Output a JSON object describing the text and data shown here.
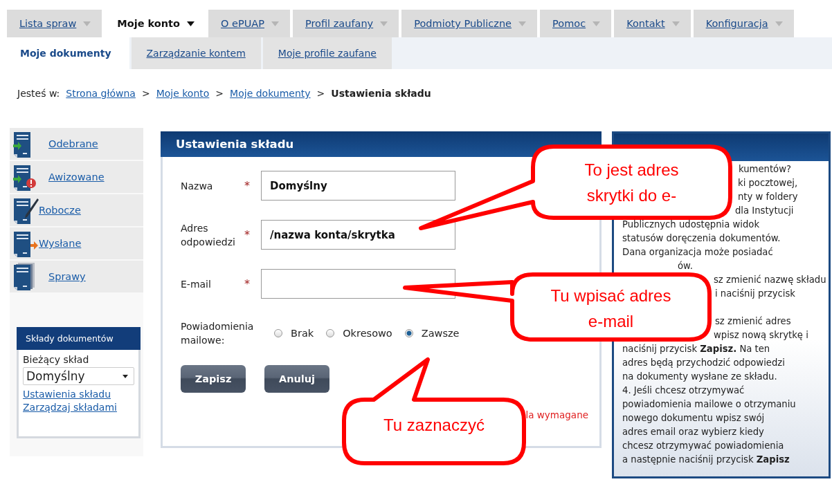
{
  "top_tabs": [
    {
      "label": "Lista spraw",
      "selected": false
    },
    {
      "label": "Moje konto",
      "selected": true
    },
    {
      "label": "O ePUAP",
      "selected": false
    },
    {
      "label": "Profil zaufany",
      "selected": false
    },
    {
      "label": "Podmioty Publiczne",
      "selected": false
    },
    {
      "label": "Pomoc",
      "selected": false
    },
    {
      "label": "Kontakt",
      "selected": false
    },
    {
      "label": "Konfiguracja",
      "selected": false
    }
  ],
  "sub_tabs": [
    {
      "label": "Moje dokumenty",
      "selected": true
    },
    {
      "label": "Zarządzanie kontem",
      "selected": false
    },
    {
      "label": "Moje profile zaufane",
      "selected": false
    }
  ],
  "breadcrumb": [
    {
      "text": "Jesteś w:",
      "kind": "prefix"
    },
    {
      "text": "Strona główna",
      "kind": "link"
    },
    {
      "text": ">",
      "kind": "separator"
    },
    {
      "text": "Moje konto",
      "kind": "link"
    },
    {
      "text": ">",
      "kind": "separator"
    },
    {
      "text": "Moje dokumenty",
      "kind": "link"
    },
    {
      "text": ">",
      "kind": "separator"
    },
    {
      "text": "Ustawienia składu",
      "kind": "current"
    }
  ],
  "sidebar": {
    "items": [
      {
        "label": "Odebrane",
        "kind": "received"
      },
      {
        "label": "Awizowane",
        "kind": "notice"
      },
      {
        "label": "Robocze",
        "kind": "draft"
      },
      {
        "label": "Wysłane",
        "kind": "sent"
      },
      {
        "label": "Sprawy",
        "kind": "cases"
      }
    ]
  },
  "store_box": {
    "title": "Składy dokumentów",
    "current_label": "Bieżący skład",
    "select_value": "Domyślny",
    "links": [
      "Ustawienia składu",
      "Zarządzaj składami"
    ]
  },
  "form": {
    "title": "Ustawienia składu",
    "fields": [
      {
        "label": "Nazwa",
        "required_mark": "*",
        "value": "Domyślny"
      },
      {
        "label": "Adres odpowiedzi",
        "required_mark": "*",
        "value": "/nazwa konta/skrytka"
      },
      {
        "label": "E-mail",
        "required_mark": "*"
      }
    ],
    "notifications": {
      "label": "Powiadomienia mailowe:",
      "options": [
        {
          "label": "Brak",
          "selected": false
        },
        {
          "label": "Okresowo",
          "selected": false
        },
        {
          "label": "Zawsze",
          "selected": true
        }
      ]
    },
    "buttons": [
      "Zapisz",
      "Anuluj"
    ],
    "required_note": "la wymagane"
  },
  "help_panel": {
    "lines_top": [
      "kumentów?",
      "ki pocztowej,",
      "nty w foldery",
      "dla Instytucji",
      "Publicznych udostępnia widok",
      "statusów doręczenia dokumentów.",
      "Dana organizacja może posiadać",
      "ów.",
      "sz zmienić nazwę składu",
      "i naciśnij przycisk"
    ],
    "lines_bottom": [
      "sz zmienić adres",
      "wpisz nową skrytkę i",
      "naciśnij przycisk **Zapisz.** Na ten",
      "adres będą przychodzić odpowiedzi",
      "na dokumenty wysłane ze składu.",
      "4. Jeśli chcesz otrzymywać",
      "powiadomienia mailowe o otrzymaniu",
      "nowego dokumentu wpisz swój",
      "adres email oraz wybierz kiedy",
      "chcesz otrzymywać powiadomienia",
      "a następnie naciśnij przycisk **Zapisz**"
    ]
  },
  "callouts": [
    {
      "lines": [
        "To jest adres",
        "skrytki do e-"
      ]
    },
    {
      "lines": [
        "Tu wpisać adres",
        "e-mail"
      ]
    },
    {
      "lines": [
        "Tu zaznaczyć"
      ]
    }
  ]
}
